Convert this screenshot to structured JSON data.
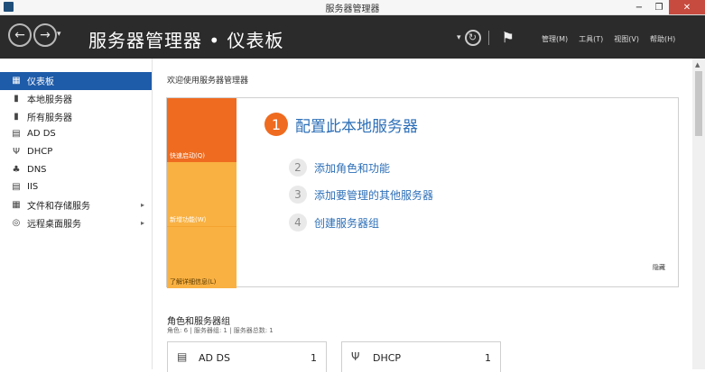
{
  "window": {
    "title": "服务器管理器",
    "controls": [
      "−",
      "❐",
      "✕"
    ]
  },
  "header": {
    "back_icon": "←",
    "forward_icon": "→",
    "dropdown_icon": "▾",
    "title": "服务器管理器 • 仪表板",
    "refresh_icon": "↻",
    "flag_icon": "⚑",
    "menu": [
      "管理(M)",
      "工具(T)",
      "视图(V)",
      "帮助(H)"
    ]
  },
  "sidebar": {
    "items": [
      {
        "label": "仪表板",
        "icon": "▦",
        "active": true
      },
      {
        "label": "本地服务器",
        "icon": "▮"
      },
      {
        "label": "所有服务器",
        "icon": "▮"
      },
      {
        "label": "AD DS",
        "icon": "▤"
      },
      {
        "label": "DHCP",
        "icon": "Ψ"
      },
      {
        "label": "DNS",
        "icon": "♣"
      },
      {
        "label": "IIS",
        "icon": "▤"
      },
      {
        "label": "文件和存储服务",
        "icon": "▦",
        "arrow": "▸"
      },
      {
        "label": "远程桌面服务",
        "icon": "◎",
        "arrow": "▸"
      }
    ]
  },
  "main": {
    "welcome_title": "欢迎使用服务器管理器",
    "tabs": [
      "快速启动(Q)",
      "新增功能(W)",
      "了解详细信息(L)"
    ],
    "step1": {
      "num": "1",
      "label": "配置此本地服务器"
    },
    "steps": [
      {
        "num": "2",
        "label": "添加角色和功能"
      },
      {
        "num": "3",
        "label": "添加要管理的其他服务器"
      },
      {
        "num": "4",
        "label": "创建服务器组"
      }
    ],
    "hide": "隐藏",
    "roles_title": "角色和服务器组",
    "roles_sub": "角色: 6 | 服务器组: 1 | 服务器总数: 1",
    "tiles": [
      {
        "icon": "▤",
        "name": "AD DS",
        "count": "1"
      },
      {
        "icon": "Ψ",
        "name": "DHCP",
        "count": "1"
      }
    ]
  },
  "scrollbar": {
    "up_icon": "▲"
  }
}
